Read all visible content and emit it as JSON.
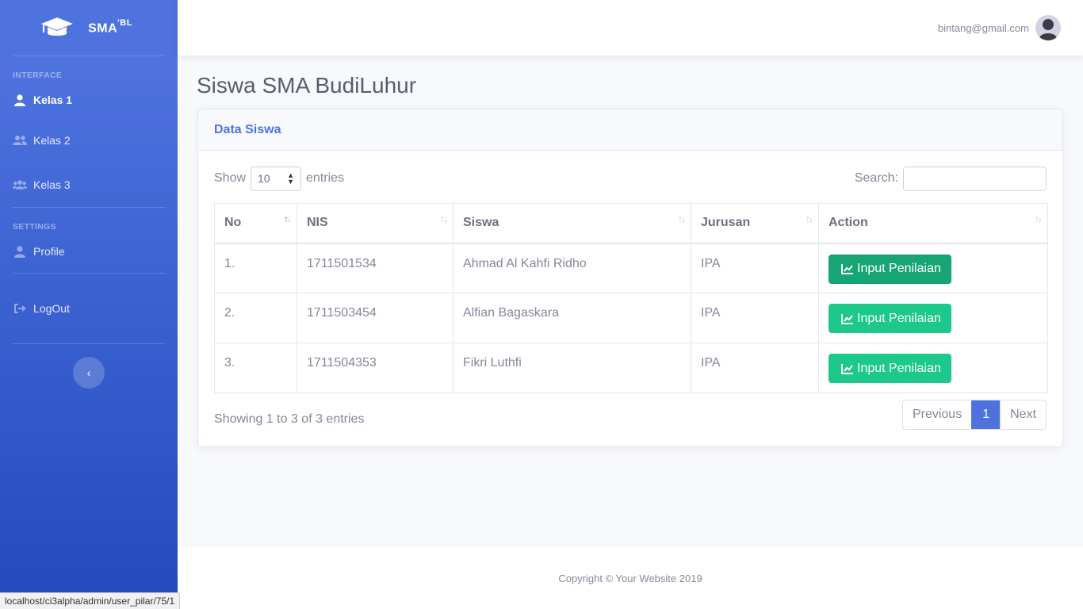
{
  "brand": {
    "name": "SMA",
    "sup": "'BL"
  },
  "sidebar": {
    "heading_interface": "INTERFACE",
    "heading_settings": "SETTINGS",
    "items": [
      {
        "label": "Kelas 1",
        "icon": "user-icon",
        "active": true
      },
      {
        "label": "Kelas 2",
        "icon": "user-friends-icon"
      },
      {
        "label": "Kelas 3",
        "icon": "users-icon"
      },
      {
        "label": "Profile",
        "icon": "user-icon"
      },
      {
        "label": "LogOut",
        "icon": "sign-out-icon"
      }
    ],
    "toggle_icon": "chevron-left-icon"
  },
  "topbar": {
    "user_email": "bintang@gmail.com"
  },
  "page": {
    "title": "Siswa SMA BudiLuhur"
  },
  "card": {
    "header": "Data Siswa",
    "show_label": "Show",
    "entries_label": "entries",
    "page_length": "10",
    "search_label": "Search:",
    "search_value": ""
  },
  "table": {
    "columns": [
      "No",
      "NIS",
      "Siswa",
      "Jurusan",
      "Action"
    ],
    "rows": [
      {
        "no": "1.",
        "nis": "1711501534",
        "siswa": "Ahmad Al Kahfi Ridho",
        "jurusan": "IPA",
        "action": "Input Penilaian"
      },
      {
        "no": "2.",
        "nis": "1711503454",
        "siswa": "Alfian Bagaskara",
        "jurusan": "IPA",
        "action": "Input Penilaian"
      },
      {
        "no": "3.",
        "nis": "1711504353",
        "siswa": "Fikri Luthfi",
        "jurusan": "IPA",
        "action": "Input Penilaian"
      }
    ]
  },
  "pagination": {
    "info": "Showing 1 to 3 of 3 entries",
    "previous": "Previous",
    "current": "1",
    "next": "Next"
  },
  "footer": {
    "copyright": "Copyright © Your Website 2019"
  },
  "statusbar": {
    "url": "localhost/ci3alpha/admin/user_pilar/75/1"
  },
  "colors": {
    "primary": "#4e73df",
    "success": "#1cc88a",
    "success_dark": "#17a673"
  }
}
